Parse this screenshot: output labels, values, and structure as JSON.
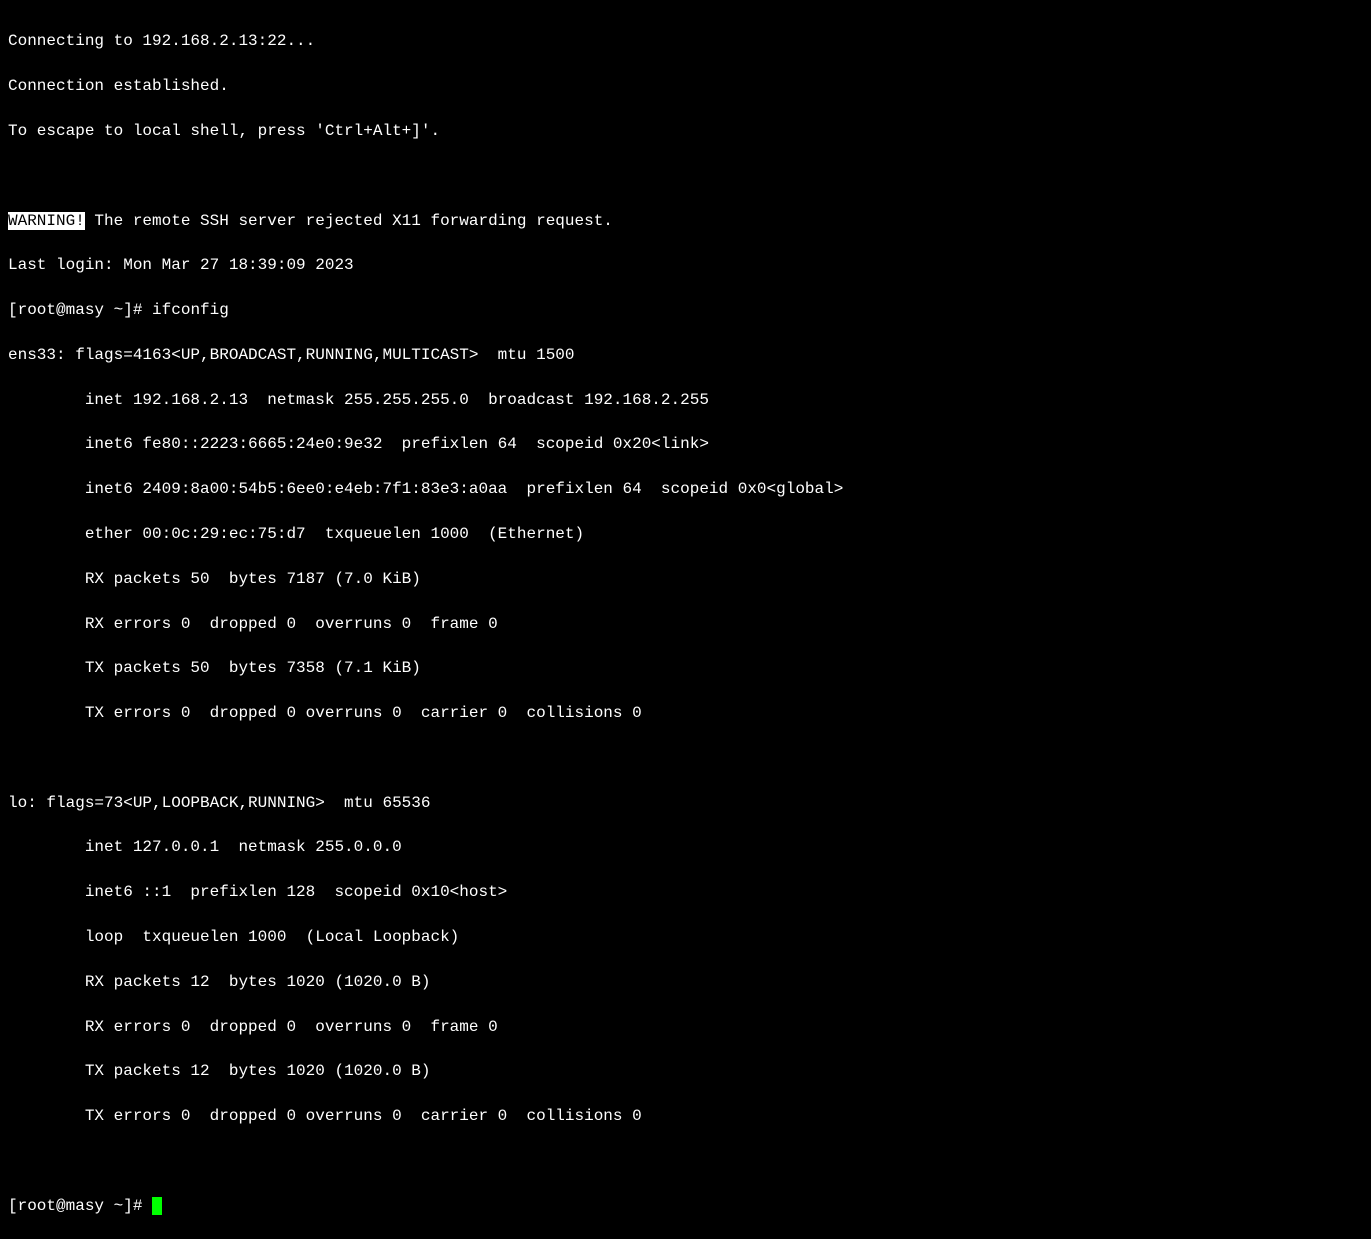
{
  "connection": {
    "connecting": "Connecting to 192.168.2.13:22...",
    "established": "Connection established.",
    "escape_hint": "To escape to local shell, press 'Ctrl+Alt+]'."
  },
  "warning": {
    "label": "WARNING!",
    "message": " The remote SSH server rejected X11 forwarding request."
  },
  "login": {
    "last_login": "Last login: Mon Mar 27 18:39:09 2023"
  },
  "prompt1": {
    "text": "[root@masy ~]# ",
    "command": "ifconfig"
  },
  "ifconfig": {
    "ens33": {
      "header": "ens33: flags=4163<UP,BROADCAST,RUNNING,MULTICAST>  mtu 1500",
      "inet": "        inet 192.168.2.13  netmask 255.255.255.0  broadcast 192.168.2.255",
      "inet6_link": "        inet6 fe80::2223:6665:24e0:9e32  prefixlen 64  scopeid 0x20<link>",
      "inet6_global": "        inet6 2409:8a00:54b5:6ee0:e4eb:7f1:83e3:a0aa  prefixlen 64  scopeid 0x0<global>",
      "ether": "        ether 00:0c:29:ec:75:d7  txqueuelen 1000  (Ethernet)",
      "rx_packets": "        RX packets 50  bytes 7187 (7.0 KiB)",
      "rx_errors": "        RX errors 0  dropped 0  overruns 0  frame 0",
      "tx_packets": "        TX packets 50  bytes 7358 (7.1 KiB)",
      "tx_errors": "        TX errors 0  dropped 0 overruns 0  carrier 0  collisions 0"
    },
    "lo": {
      "header": "lo: flags=73<UP,LOOPBACK,RUNNING>  mtu 65536",
      "inet": "        inet 127.0.0.1  netmask 255.0.0.0",
      "inet6": "        inet6 ::1  prefixlen 128  scopeid 0x10<host>",
      "loop": "        loop  txqueuelen 1000  (Local Loopback)",
      "rx_packets": "        RX packets 12  bytes 1020 (1020.0 B)",
      "rx_errors": "        RX errors 0  dropped 0  overruns 0  frame 0",
      "tx_packets": "        TX packets 12  bytes 1020 (1020.0 B)",
      "tx_errors": "        TX errors 0  dropped 0 overruns 0  carrier 0  collisions 0"
    }
  },
  "prompt2": {
    "text": "[root@masy ~]# "
  }
}
